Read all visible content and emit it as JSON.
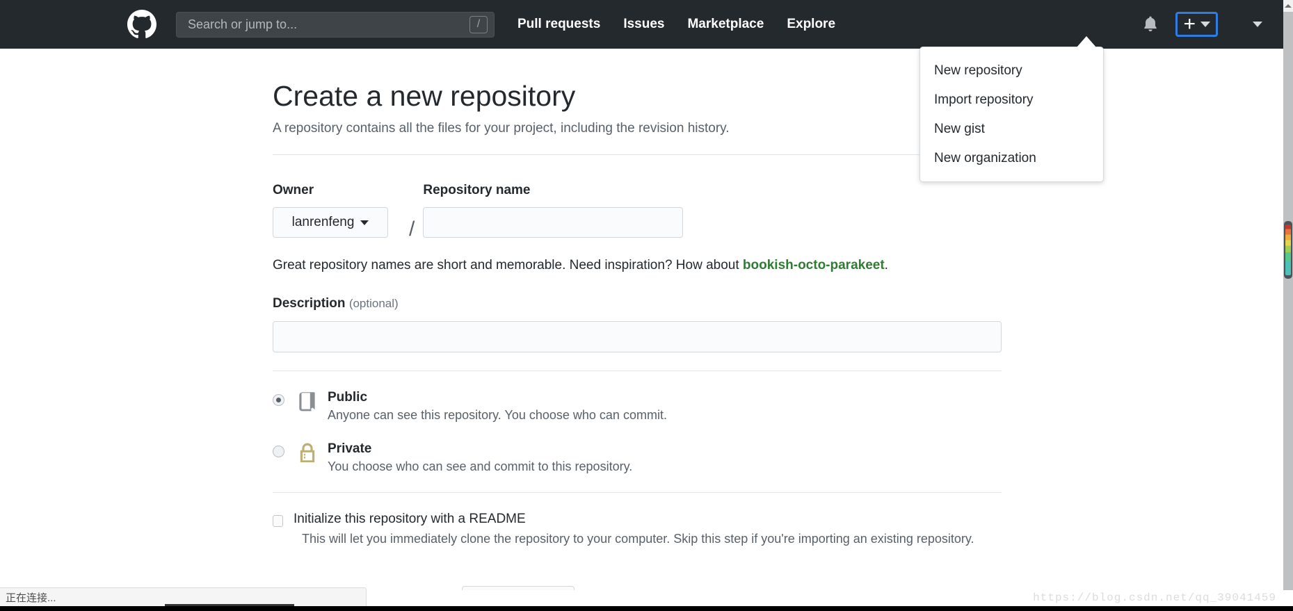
{
  "header": {
    "logo_icon": "github-mark-icon",
    "search": {
      "placeholder": "Search or jump to...",
      "value": "",
      "shortcut_badge": "/"
    },
    "nav_links": [
      {
        "label": "Pull requests"
      },
      {
        "label": "Issues"
      },
      {
        "label": "Marketplace"
      },
      {
        "label": "Explore"
      }
    ],
    "notifications_icon": "bell-icon",
    "create_new_button": {
      "glyph": "+",
      "caret_icon": "chevron-down-icon"
    },
    "account_menu": {
      "caret_icon": "chevron-down-icon"
    },
    "background_color": "#24292e",
    "focus_ring_color": "#2f7de1"
  },
  "create_new_dropdown": {
    "items": [
      {
        "label": "New repository"
      },
      {
        "label": "Import repository"
      },
      {
        "label": "New gist"
      },
      {
        "label": "New organization"
      }
    ]
  },
  "main": {
    "title": "Create a new repository",
    "subtitle": "A repository contains all the files for your project, including the revision history.",
    "owner": {
      "label": "Owner",
      "selected": "lanrenfeng",
      "caret_icon": "chevron-down-icon"
    },
    "separator": "/",
    "repository_name": {
      "label": "Repository name",
      "value": "",
      "placeholder": ""
    },
    "name_hint": {
      "prefix": "Great repository names are short and memorable. Need inspiration? How about ",
      "suggestion": "bookish-octo-parakeet",
      "suffix": ".",
      "suggestion_color": "#2f7d32"
    },
    "description": {
      "label": "Description",
      "optional_note": "(optional)",
      "value": "",
      "placeholder": ""
    },
    "visibility": [
      {
        "id": "public",
        "title": "Public",
        "description": "Anyone can see this repository. You choose who can commit.",
        "selected": true,
        "icon": "repo-book-icon",
        "icon_color": "#8a8f94"
      },
      {
        "id": "private",
        "title": "Private",
        "description": "You choose who can see and commit to this repository.",
        "selected": false,
        "icon": "lock-icon",
        "icon_color": "#bdb076"
      }
    ],
    "initialize_readme": {
      "label": "Initialize this repository with a README",
      "description": "This will let you immediately clone the repository to your computer. Skip this step if you're importing an existing repository.",
      "checked": false
    }
  },
  "browser": {
    "status_text": "正在连接...",
    "watermark": "https://blog.csdn.net/qq_39041459",
    "scrollbar": {
      "up_arrow_icon": "triangle-up-icon"
    }
  }
}
